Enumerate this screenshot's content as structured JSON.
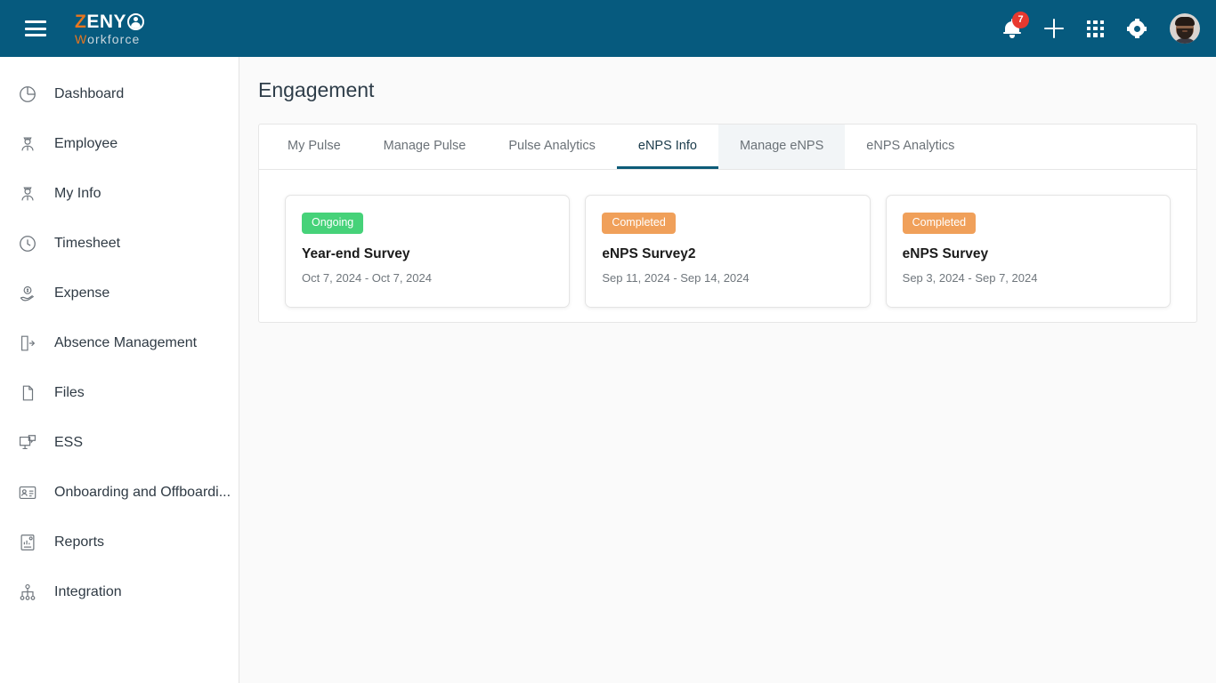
{
  "header": {
    "menu_icon": "hamburger-icon",
    "logo": {
      "part1": "Z",
      "part2": "ENY",
      "part3_w": "W",
      "part3_rest": "orkforce"
    },
    "notifications_badge": "7",
    "icons": [
      "bell-icon",
      "plus-icon",
      "apps-grid-icon",
      "gear-icon",
      "avatar"
    ]
  },
  "sidebar": {
    "items": [
      {
        "label": "Dashboard",
        "icon": "pie-chart-icon"
      },
      {
        "label": "Employee",
        "icon": "employee-icon"
      },
      {
        "label": "My Info",
        "icon": "employee-icon"
      },
      {
        "label": "Timesheet",
        "icon": "clock-icon"
      },
      {
        "label": "Expense",
        "icon": "money-hand-icon"
      },
      {
        "label": "Absence Management",
        "icon": "door-exit-icon"
      },
      {
        "label": "Files",
        "icon": "document-icon"
      },
      {
        "label": "ESS",
        "icon": "monitor-chat-icon"
      },
      {
        "label": "Onboarding and Offboardi...",
        "icon": "id-card-icon"
      },
      {
        "label": "Reports",
        "icon": "report-chart-icon"
      },
      {
        "label": "Integration",
        "icon": "sitemap-icon"
      }
    ]
  },
  "main": {
    "title": "Engagement",
    "tabs": [
      {
        "label": "My Pulse",
        "state": "normal"
      },
      {
        "label": "Manage Pulse",
        "state": "normal"
      },
      {
        "label": "Pulse Analytics",
        "state": "normal"
      },
      {
        "label": "eNPS Info",
        "state": "active"
      },
      {
        "label": "Manage eNPS",
        "state": "hovered"
      },
      {
        "label": "eNPS Analytics",
        "state": "normal"
      }
    ],
    "cards": [
      {
        "status": "Ongoing",
        "status_kind": "ongoing",
        "title": "Year-end Survey",
        "dates": "Oct 7, 2024 - Oct 7, 2024"
      },
      {
        "status": "Completed",
        "status_kind": "completed",
        "title": "eNPS Survey2",
        "dates": "Sep 11, 2024 - Sep 14, 2024"
      },
      {
        "status": "Completed",
        "status_kind": "completed",
        "title": "eNPS Survey",
        "dates": "Sep 3, 2024 - Sep 7, 2024"
      }
    ]
  },
  "colors": {
    "header_bg": "#065a7e",
    "accent_orange": "#e8761f",
    "badge_red": "#e8392f",
    "status_green": "#46d279",
    "status_orange": "#f0a05a",
    "tab_active": "#0d5b78"
  }
}
